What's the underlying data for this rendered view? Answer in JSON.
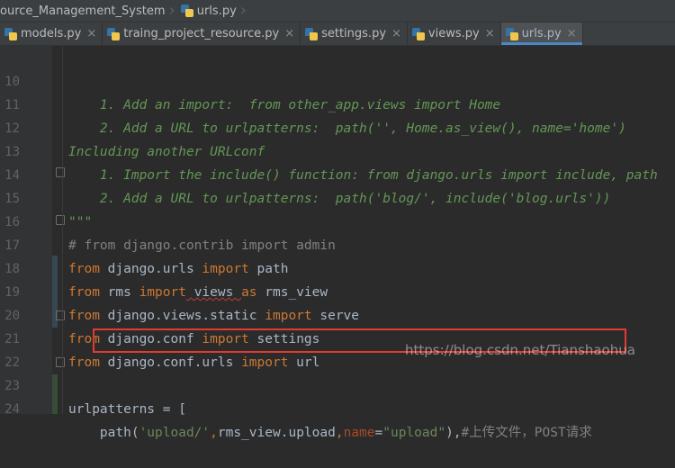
{
  "breadcrumb": {
    "project": "ource_Management_System",
    "file": "urls.py"
  },
  "tabs": [
    {
      "label": "models.py",
      "active": false
    },
    {
      "label": "traing_project_resource.py",
      "active": false
    },
    {
      "label": "settings.py",
      "active": false
    },
    {
      "label": "views.py",
      "active": false
    },
    {
      "label": "urls.py",
      "active": true
    }
  ],
  "tab_close_glyph": "×",
  "editor": {
    "lines": [
      {
        "num": "10",
        "t1": "    1. Add an import:  from other_app.views import Home"
      },
      {
        "num": "11",
        "t1": "    2. Add a URL to urlpatterns:  path('', Home.as_view(), name='home')"
      },
      {
        "num": "12",
        "t1": "Including another URLconf"
      },
      {
        "num": "13",
        "t1": "    1. Import the include() function: from django.urls import include, path"
      },
      {
        "num": "14",
        "t1": "    2. Add a URL to urlpatterns:  path('blog/', include('blog.urls'))"
      },
      {
        "num": "15",
        "t1": "\"\"\""
      },
      {
        "num": "16",
        "t1": "# from django.contrib import admin"
      },
      {
        "num": "17",
        "t1": "from",
        "t2": " django.urls ",
        "t3": "import",
        "t4": " path"
      },
      {
        "num": "18",
        "t1": "from",
        "t2": " rms ",
        "t3": "import",
        "t4": " views ",
        "t5": "as",
        "t6": " rms_view"
      },
      {
        "num": "19",
        "t1": "from",
        "t2": " django.views.static ",
        "t3": "import",
        "t4": " serve"
      },
      {
        "num": "20",
        "t1": "from",
        "t2": " django.conf ",
        "t3": "import",
        "t4": " settings"
      },
      {
        "num": "21",
        "t1": "from",
        "t2": " django.conf.urls ",
        "t3": "import",
        "t4": " url"
      },
      {
        "num": "22"
      },
      {
        "num": "23",
        "t1": "urlpatterns = ["
      },
      {
        "num": "24",
        "t1": "    path(",
        "t2": "'upload/'",
        "t3": ",",
        "t4": "rms_view.upload",
        "t5": ",",
        "t6": "name",
        "t7": "=",
        "t8": "\"upload\"",
        "t9": "),",
        "t10": "#上传文件，POST请求"
      }
    ]
  },
  "watermark": "https://blog.csdn.net/Tianshaohua",
  "colors": {
    "background": "#2b2b2b",
    "keyword": "#cc7832",
    "string": "#6a8759",
    "docstring": "#629755",
    "comment": "#808080",
    "highlight_box": "#e03c31",
    "active_tab_underline": "#4a88c7"
  }
}
